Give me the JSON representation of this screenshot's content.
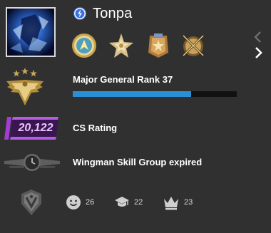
{
  "profile": {
    "player_name": "Tonpa"
  },
  "medals": [
    "faceit-medal-icon",
    "star-medal-icon",
    "service-medal-icon",
    "crossed-weapons-medal-icon"
  ],
  "rank": {
    "label": "Major General Rank 37",
    "xp_progress": 0.72,
    "accent_color": "#2b8fd6"
  },
  "rating": {
    "value": "20,122",
    "label": "CS Rating",
    "badge_color": "#8e2bc4"
  },
  "wingman": {
    "label": "Wingman Skill Group expired"
  },
  "commendations": {
    "friendly": "26",
    "teacher": "22",
    "leader": "23"
  }
}
